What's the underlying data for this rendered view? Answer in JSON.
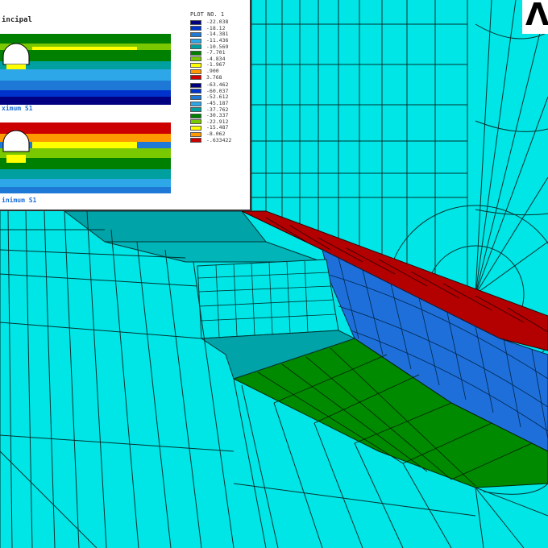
{
  "inset": {
    "title1": "incipal",
    "title2": "ximum S1",
    "caption": "inimum S1",
    "plot_label": "PLOT NO.   1",
    "legend1": [
      {
        "value": "-22.038",
        "color": "#000080"
      },
      {
        "value": "-18.12",
        "color": "#0033cc"
      },
      {
        "value": "-14.381",
        "color": "#1e78d6"
      },
      {
        "value": "-11.436",
        "color": "#2ea7e8"
      },
      {
        "value": "-10.569",
        "color": "#00a0a0"
      },
      {
        "value": "-7.701",
        "color": "#008000"
      },
      {
        "value": "-4.834",
        "color": "#7ac800"
      },
      {
        "value": "-1.967",
        "color": "#ffff00"
      },
      {
        "value": ".900",
        "color": "#ff9900"
      },
      {
        "value": "3.768",
        "color": "#cc0000"
      }
    ],
    "legend2": [
      {
        "value": "-63.462",
        "color": "#000080"
      },
      {
        "value": "-60.037",
        "color": "#0033cc"
      },
      {
        "value": "-52.612",
        "color": "#1e78d6"
      },
      {
        "value": "-45.187",
        "color": "#2ea7e8"
      },
      {
        "value": "-37.762",
        "color": "#00a0a0"
      },
      {
        "value": "-30.337",
        "color": "#008000"
      },
      {
        "value": "-22.912",
        "color": "#7ac800"
      },
      {
        "value": "-15.487",
        "color": "#ffff00"
      },
      {
        "value": "-8.062",
        "color": "#ff9900"
      },
      {
        "value": "-.633422",
        "color": "#cc0000"
      }
    ]
  },
  "logo": {
    "glyph": "Λ"
  },
  "colors": {
    "mesh_bg": "#00e5e5",
    "mesh_lines": "#003333",
    "mesh_cyan_dark": "#00a3a8",
    "band_red": "#b30000",
    "band_blue": "#1e6fd9",
    "band_green": "#008a00"
  }
}
